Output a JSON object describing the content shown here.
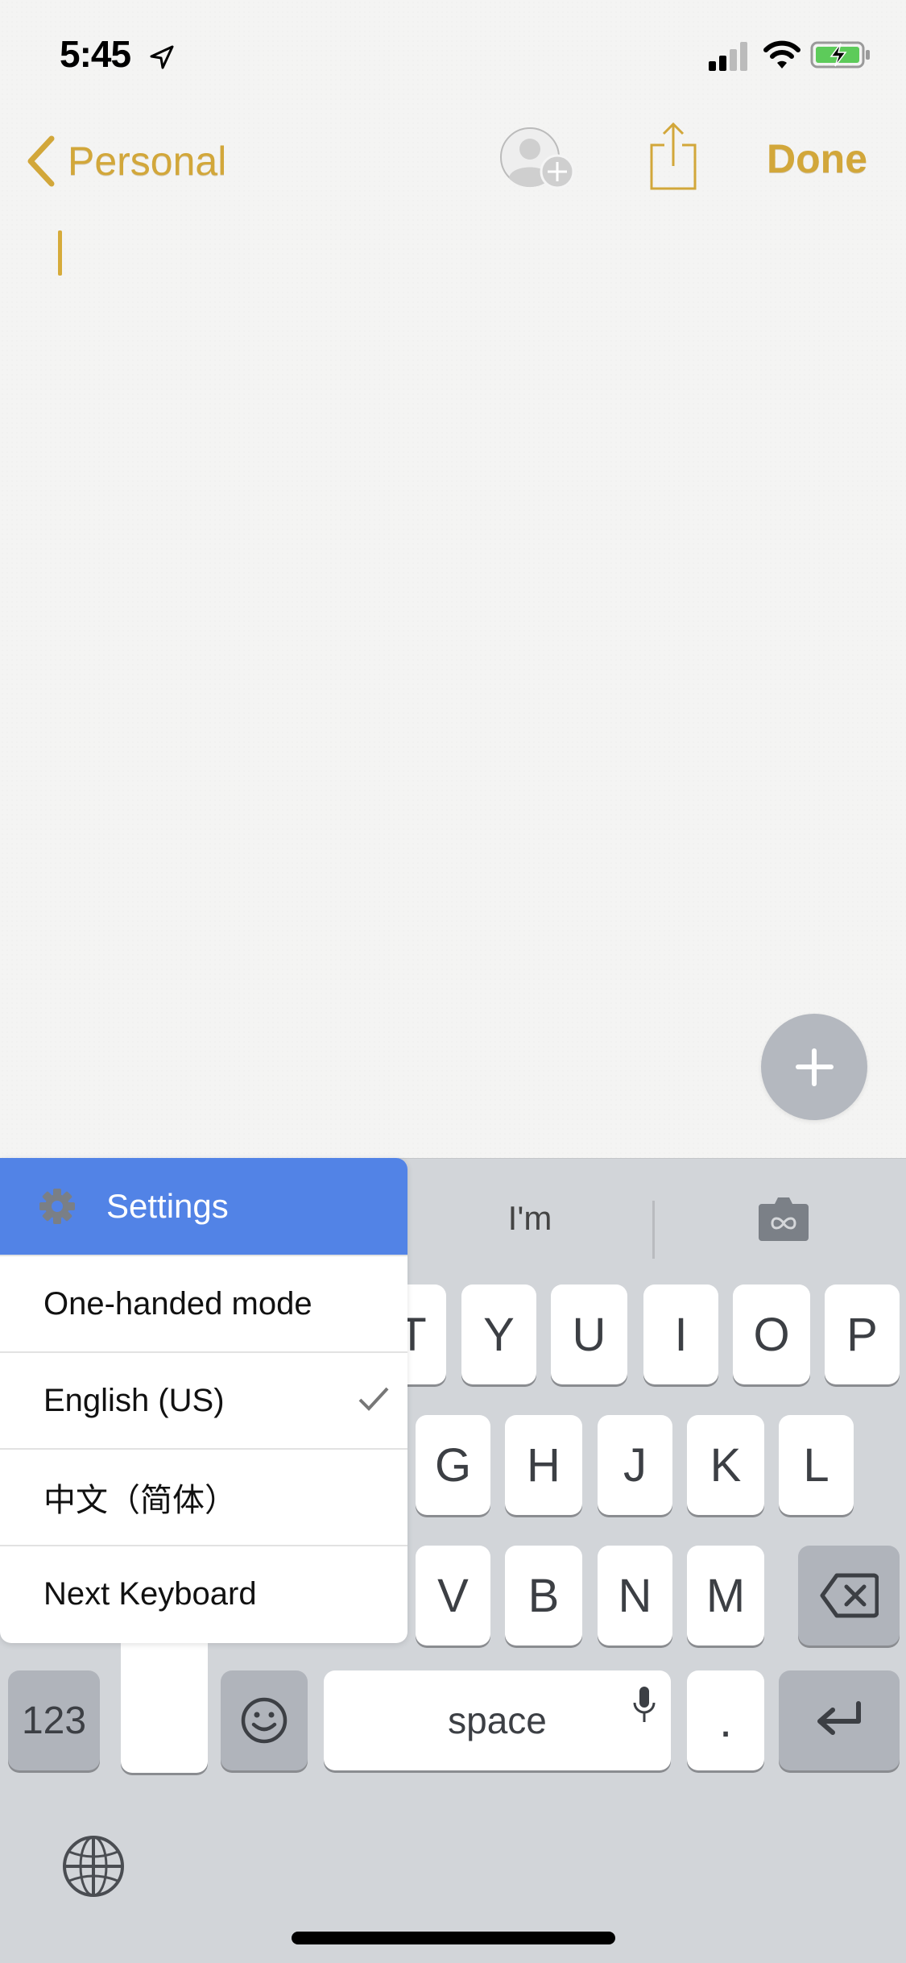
{
  "status_bar": {
    "time": "5:45",
    "icons": [
      "location-arrow-icon",
      "cellular-signal-icon",
      "wifi-icon",
      "battery-charging-icon"
    ]
  },
  "nav": {
    "back_label": "Personal",
    "done_label": "Done",
    "icons": [
      "chevron-left-icon",
      "add-person-icon",
      "share-icon"
    ]
  },
  "colors": {
    "accent": "#d2a73a",
    "menu_header": "#5283e6",
    "keyboard_bg": "#d2d5d9",
    "fab": "#b4b8bf"
  },
  "keyboard": {
    "suggestion": "I'm",
    "gif_icon": "gif-camera-icon",
    "row1_visible": [
      "T",
      "Y",
      "U",
      "I",
      "O",
      "P"
    ],
    "row2_visible": [
      "G",
      "H",
      "J",
      "K",
      "L"
    ],
    "row3_visible": [
      "V",
      "B",
      "N",
      "M"
    ],
    "numbers_label": "123",
    "space_label": "space",
    "period_label": "."
  },
  "menu": {
    "header": "Settings",
    "items": [
      {
        "label": "One-handed mode",
        "checked": false
      },
      {
        "label": "English (US)",
        "checked": true
      },
      {
        "label": "中文（简体）",
        "checked": false
      },
      {
        "label": "Next Keyboard",
        "checked": false
      }
    ]
  }
}
